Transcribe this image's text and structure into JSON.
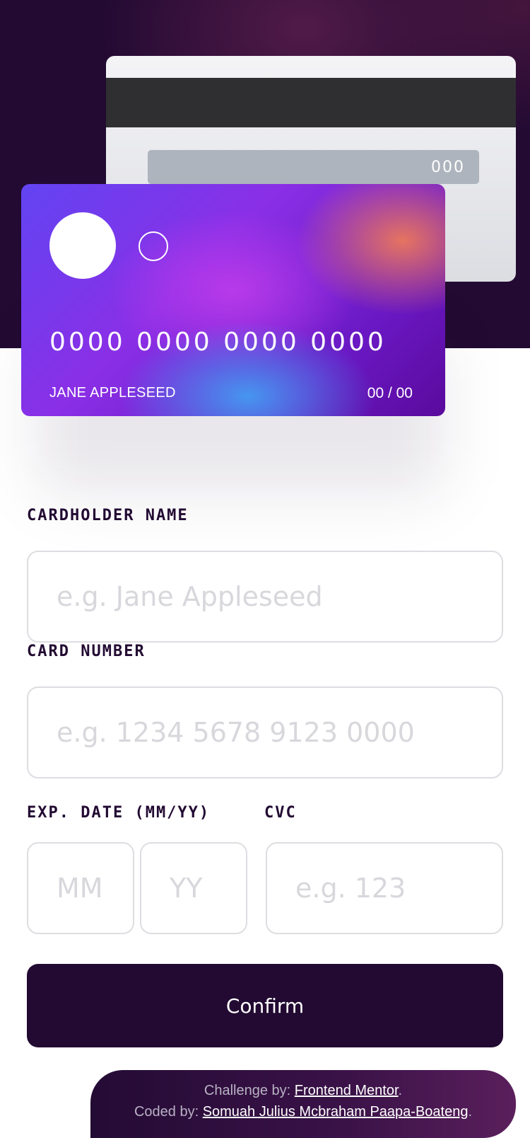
{
  "card_back": {
    "cvc": "000"
  },
  "card_front": {
    "number": "0000 0000 0000 0000",
    "holder": "JANE APPLESEED",
    "expiry": "00 / 00"
  },
  "form": {
    "cardholder": {
      "label": "CARDHOLDER NAME",
      "placeholder": "e.g. Jane Appleseed"
    },
    "card_number": {
      "label": "CARD NUMBER",
      "placeholder": "e.g. 1234 5678 9123 0000"
    },
    "exp_date": {
      "label": "EXP. DATE (MM/YY)",
      "mm_placeholder": "MM",
      "yy_placeholder": "YY"
    },
    "cvc": {
      "label": "CVC",
      "placeholder": "e.g. 123"
    },
    "confirm_label": "Confirm"
  },
  "attribution": {
    "challenge_prefix": "Challenge by: ",
    "challenge_link": "Frontend Mentor",
    "coded_prefix": "Coded by: ",
    "coded_link": "Somuah Julius Mcbraham Paapa-Boateng",
    "period": "."
  },
  "colors": {
    "header_bg": "#220a32",
    "accent_dark": "#220a32",
    "input_border": "#dedde2",
    "placeholder": "#d8d7dc"
  }
}
